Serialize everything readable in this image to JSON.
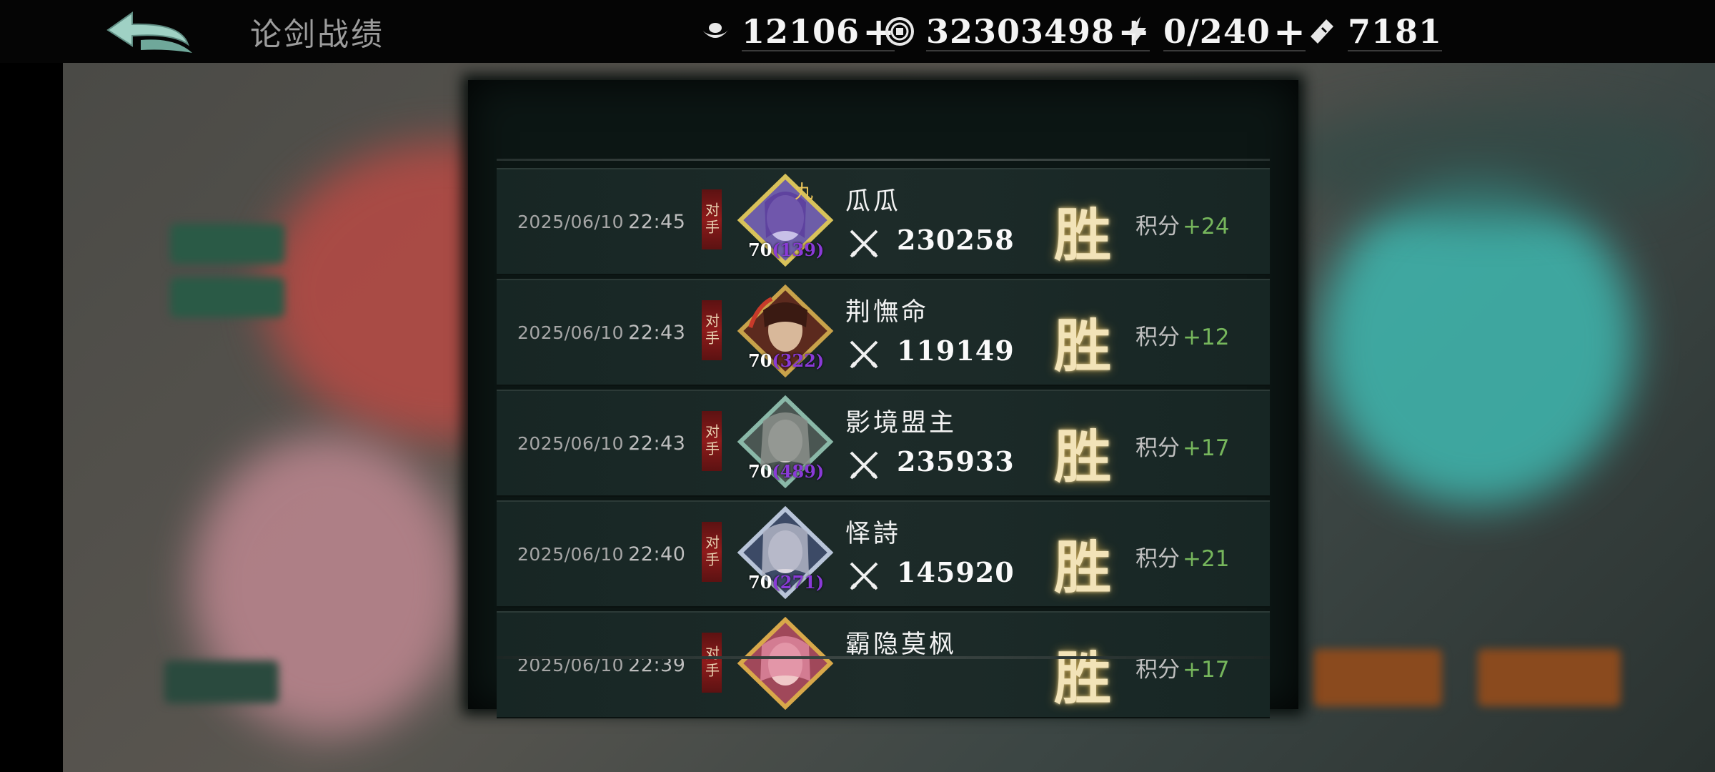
{
  "header": {
    "title": "论剑战绩",
    "back_icon": "back-arrow-icon"
  },
  "resources": [
    {
      "icon": "silver-ingot-icon",
      "value": "12106",
      "plus": "+"
    },
    {
      "icon": "copper-coin-icon",
      "value": "32303498",
      "plus": "+"
    },
    {
      "icon": "lightning-stamina-icon",
      "value": "0/240",
      "plus": "+"
    },
    {
      "icon": "ticket-icon",
      "value": "7181"
    }
  ],
  "records": [
    {
      "date": "2025/06/10",
      "time": "22:45",
      "tag": "对手",
      "level": "70",
      "stars": "(139)",
      "name": "瓜瓜",
      "power": "230258",
      "result": "胜",
      "score_label": "积分",
      "score_delta": "+24"
    },
    {
      "date": "2025/06/10",
      "time": "22:43",
      "tag": "对手",
      "level": "70",
      "stars": "(322)",
      "name": "荆憮命",
      "power": "119149",
      "result": "胜",
      "score_label": "积分",
      "score_delta": "+12"
    },
    {
      "date": "2025/06/10",
      "time": "22:43",
      "tag": "对手",
      "level": "70",
      "stars": "(489)",
      "name": "影境盟主",
      "power": "235933",
      "result": "胜",
      "score_label": "积分",
      "score_delta": "+17"
    },
    {
      "date": "2025/06/10",
      "time": "22:40",
      "tag": "对手",
      "level": "70",
      "stars": "(271)",
      "name": "怿詩",
      "power": "145920",
      "result": "胜",
      "score_label": "积分",
      "score_delta": "+21"
    },
    {
      "date": "2025/06/10",
      "time": "22:39",
      "tag": "对手",
      "level": "",
      "stars": "",
      "name": "霸隐莫枫",
      "power": "",
      "result": "胜",
      "score_label": "积分",
      "score_delta": "+17"
    }
  ],
  "colors": {
    "panel_bg": "#0c1614",
    "win_glow": "#f2e3b8",
    "score_delta": "#76b65c",
    "tag_red": "#8e1b1b",
    "level_stars": "#8a3ad8"
  }
}
